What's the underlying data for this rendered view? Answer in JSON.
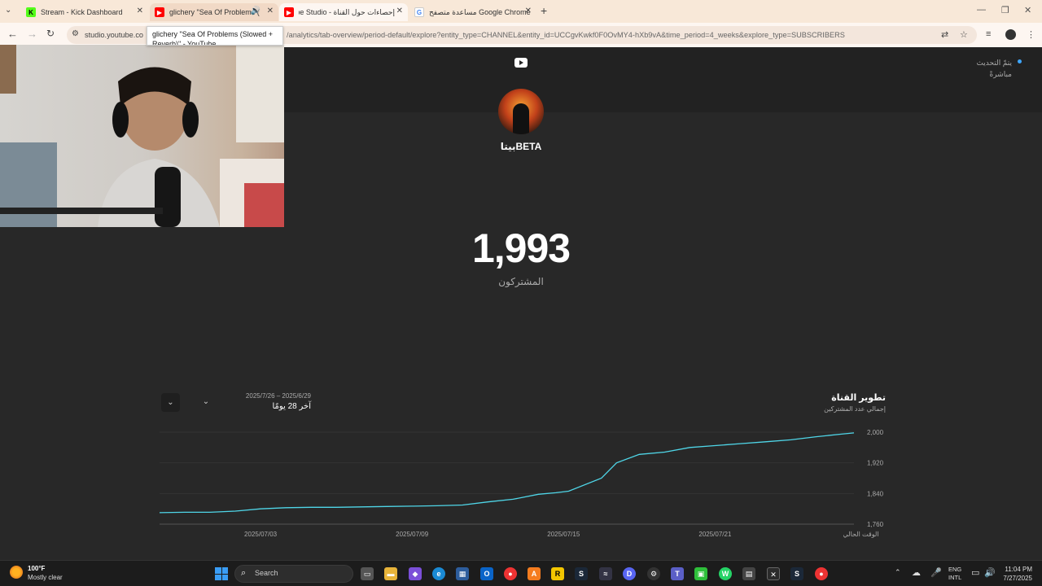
{
  "browser": {
    "tabs": [
      {
        "title": "Stream - Kick Dashboard",
        "favicon": "kick-icon",
        "color": "#53fc18"
      },
      {
        "title": "glichery \"Sea Of Problems (",
        "favicon": "youtube-icon",
        "color": "#ff0000",
        "audio": true
      },
      {
        "title": "إحصاءات حول القناة - YouTube Studio",
        "favicon": "youtube-studio-icon",
        "color": "#ff0000"
      },
      {
        "title": "مساعدة متصفح Google Chrome",
        "favicon": "google-icon",
        "color": "#4285f4"
      }
    ],
    "url_host": "studio.youtube.co",
    "url_path": "/analytics/tab-overview/period-default/explore?entity_type=CHANNEL&entity_id=UCCgvKwkf0F0OvMY4-hXb9vA&time_period=4_weeks&explore_type=SUBSCRIBERS",
    "tooltip_line1": "glichery \"Sea Of Problems (Slowed +",
    "tooltip_line2": "Reverb)\" - YouTube"
  },
  "page": {
    "live_status": "يتمّ التحديث",
    "live_status_2": "مباشرةً",
    "channel_name": "بيتاBETA",
    "subscriber_count": "1,993",
    "subscriber_label": "المشتركون",
    "chart_title": "تطوير القناة",
    "chart_subtitle": "إجمالي عدد المشتركين",
    "date_range": "2025/7/26 – 2025/6/29",
    "period_label": "آخر 28 يومًا"
  },
  "chart_data": {
    "type": "line",
    "x_tick_labels": [
      "2025/07/03",
      "2025/07/09",
      "2025/07/15",
      "2025/07/21",
      "الوقت الحالي"
    ],
    "x_tick_days": [
      4,
      10,
      16,
      22,
      28
    ],
    "y_tick_labels": [
      "2,000",
      "1,920",
      "1,840",
      "1,760"
    ],
    "ylim": [
      1760,
      2000
    ],
    "grid": true,
    "series_color": "#4fd6e8",
    "x": [
      0,
      1,
      2,
      3,
      4,
      5,
      6,
      7,
      8,
      9,
      10,
      11,
      12,
      13,
      14,
      15,
      15.7,
      16.2,
      17.5,
      18.1,
      19,
      20,
      21,
      22,
      23,
      24,
      25,
      26,
      27,
      27.5
    ],
    "y": [
      1790,
      1791,
      1791,
      1794,
      1800,
      1803,
      1804,
      1804,
      1805,
      1806,
      1807,
      1808,
      1810,
      1818,
      1825,
      1838,
      1842,
      1846,
      1880,
      1920,
      1942,
      1948,
      1960,
      1965,
      1970,
      1975,
      1980,
      1988,
      1995,
      1998
    ]
  },
  "taskbar": {
    "weather_temp": "100°F",
    "weather_desc": "Mostly clear",
    "search_placeholder": "Search",
    "lang_1": "ENG",
    "lang_2": "INTL",
    "time": "11:04 PM",
    "date": "7/27/2025"
  }
}
